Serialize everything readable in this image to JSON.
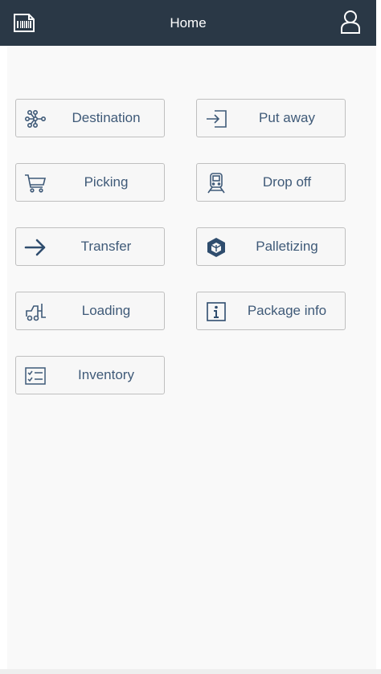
{
  "header": {
    "title": "Home",
    "app_icon": "barcode-scanner-icon",
    "user_icon": "user-icon"
  },
  "tiles": [
    {
      "label": "Destination",
      "icon": "network-nodes-icon"
    },
    {
      "label": "Put away",
      "icon": "enter-arrow-icon"
    },
    {
      "label": "Picking",
      "icon": "cart-icon"
    },
    {
      "label": "Drop off",
      "icon": "train-icon"
    },
    {
      "label": "Transfer",
      "icon": "right-arrow-icon"
    },
    {
      "label": "Palletizing",
      "icon": "cube-icon"
    },
    {
      "label": "Loading",
      "icon": "forklift-icon"
    },
    {
      "label": "Package info",
      "icon": "info-icon"
    },
    {
      "label": "Inventory",
      "icon": "checklist-icon"
    }
  ],
  "colors": {
    "header_bg": "#2a3846",
    "tile_text": "#3f5a78",
    "tile_border": "#bfbfbf",
    "content_bg": "#f9f9f9"
  }
}
